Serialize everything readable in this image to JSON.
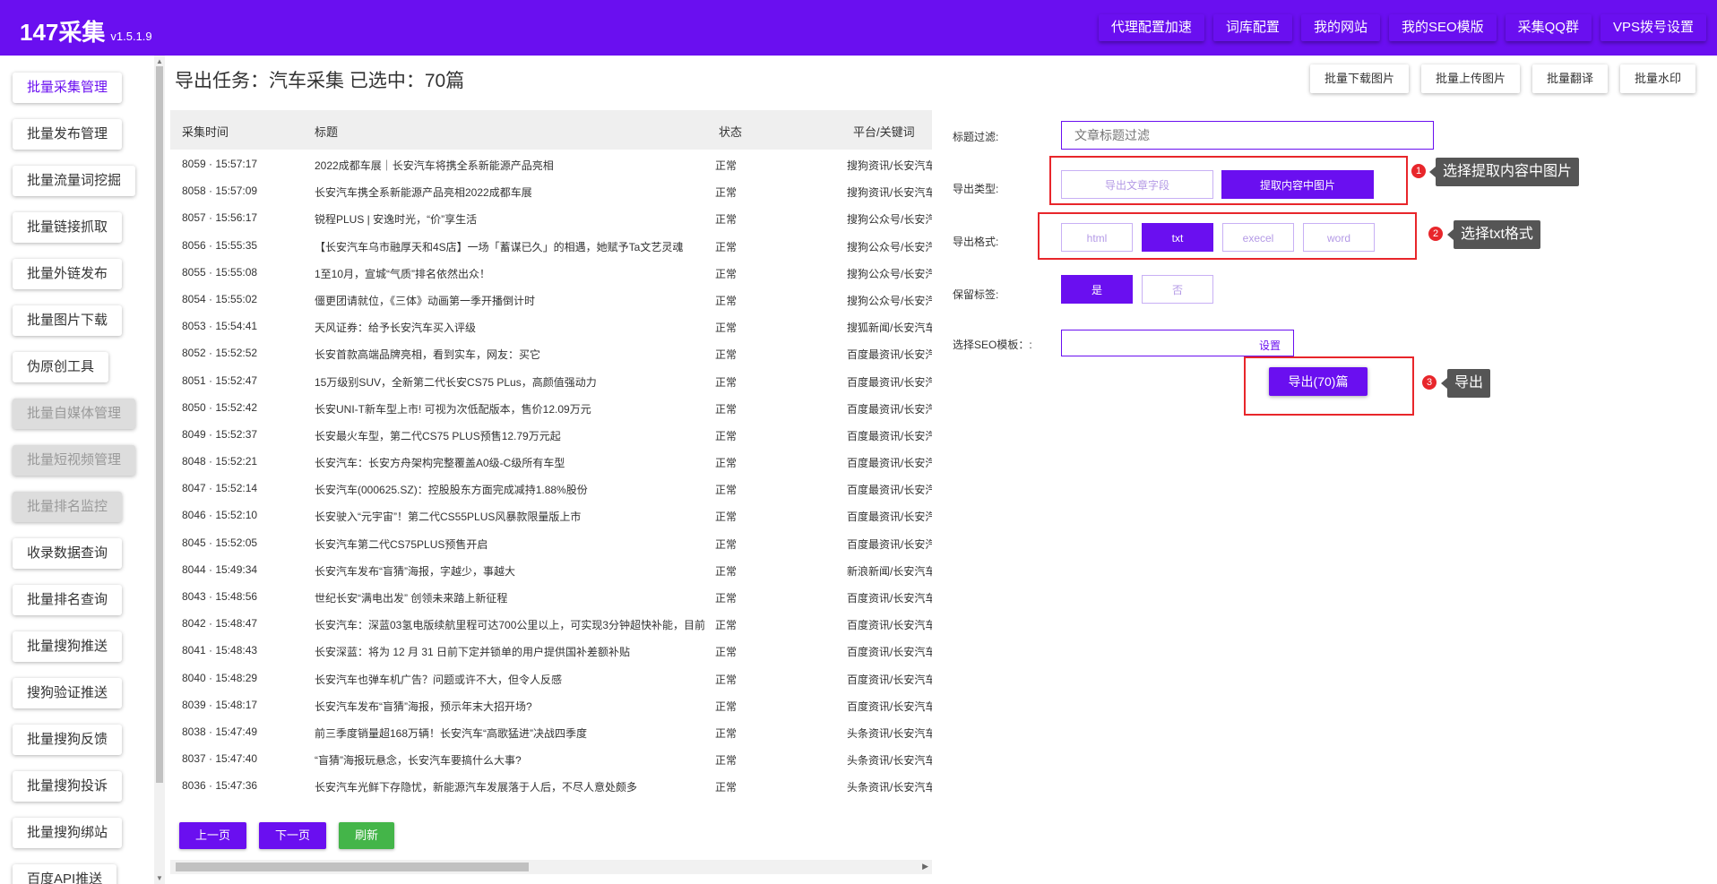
{
  "header": {
    "logo": "147采集",
    "version": "v1.5.1.9",
    "nav": [
      "代理配置加速",
      "词库配置",
      "我的网站",
      "我的SEO模版",
      "采集QQ群",
      "VPS拨号设置"
    ]
  },
  "sidebar": {
    "items": [
      {
        "label": "批量采集管理",
        "state": "active"
      },
      {
        "label": "批量发布管理",
        "state": "normal"
      },
      {
        "label": "批量流量词挖掘",
        "state": "normal"
      },
      {
        "label": "批量链接抓取",
        "state": "normal"
      },
      {
        "label": "批量外链发布",
        "state": "normal"
      },
      {
        "label": "批量图片下载",
        "state": "normal"
      },
      {
        "label": "伪原创工具",
        "state": "normal"
      },
      {
        "label": "批量自媒体管理",
        "state": "disabled"
      },
      {
        "label": "批量短视频管理",
        "state": "disabled"
      },
      {
        "label": "批量排名监控",
        "state": "disabled"
      },
      {
        "label": "收录数据查询",
        "state": "normal"
      },
      {
        "label": "批量排名查询",
        "state": "normal"
      },
      {
        "label": "批量搜狗推送",
        "state": "normal"
      },
      {
        "label": "搜狗验证推送",
        "state": "normal"
      },
      {
        "label": "批量搜狗反馈",
        "state": "normal"
      },
      {
        "label": "批量搜狗投诉",
        "state": "normal"
      },
      {
        "label": "批量搜狗绑站",
        "state": "normal"
      },
      {
        "label": "百度API推送",
        "state": "normal"
      }
    ]
  },
  "main": {
    "title": "导出任务：汽车采集 已选中：70篇",
    "toolbar": [
      "批量下载图片",
      "批量上传图片",
      "批量翻译",
      "批量水印"
    ],
    "table": {
      "headers": [
        "采集时间",
        "标题",
        "状态",
        "平台/关键词"
      ],
      "rows": [
        [
          "8059 · 15:57:17",
          "2022成都车展｜长安汽车将携全系新能源产品亮相",
          "正常",
          "搜狗资讯/长安汽车"
        ],
        [
          "8058 · 15:57:09",
          "长安汽车携全系新能源产品亮相2022成都车展",
          "正常",
          "搜狗资讯/长安汽车"
        ],
        [
          "8057 · 15:56:17",
          "锐程PLUS | 安逸时光，“价”享生活",
          "正常",
          "搜狗公众号/长安汽车"
        ],
        [
          "8056 · 15:55:35",
          "【长安汽车乌市融厚天和4S店】一场「蓄谋已久」的相遇，她赋予Ta文艺灵魂",
          "正常",
          "搜狗公众号/长安汽车"
        ],
        [
          "8055 · 15:55:08",
          "1至10月，宣城“气质”排名依然出众！",
          "正常",
          "搜狗公众号/长安汽车"
        ],
        [
          "8054 · 15:55:02",
          "僵更团请就位，《三体》动画第一季开播倒计时",
          "正常",
          "搜狗公众号/长安汽车"
        ],
        [
          "8053 · 15:54:41",
          "天风证券：给予长安汽车买入评级",
          "正常",
          "搜狐新闻/长安汽车"
        ],
        [
          "8052 · 15:52:52",
          "长安首款高端品牌亮相，看到实车，网友：买它",
          "正常",
          "百度最资讯/长安汽车"
        ],
        [
          "8051 · 15:52:47",
          "15万级别SUV，全新第二代长安CS75 PLus，高颜值强动力",
          "正常",
          "百度最资讯/长安汽车"
        ],
        [
          "8050 · 15:52:42",
          "长安UNI-T新车型上市! 可视为次低配版本，售价12.09万元",
          "正常",
          "百度最资讯/长安汽车"
        ],
        [
          "8049 · 15:52:37",
          "长安最火车型，第二代CS75 PLUS预售12.79万元起",
          "正常",
          "百度最资讯/长安汽车"
        ],
        [
          "8048 · 15:52:21",
          "长安汽车：长安方舟架构完整覆盖A0级-C级所有车型",
          "正常",
          "百度最资讯/长安汽车"
        ],
        [
          "8047 · 15:52:14",
          "长安汽车(000625.SZ)：控股股东方面完成减持1.88%股份",
          "正常",
          "百度最资讯/长安汽车"
        ],
        [
          "8046 · 15:52:10",
          "长安驶入“元宇宙”！第二代CS55PLUS风暴款限量版上市",
          "正常",
          "百度最资讯/长安汽车"
        ],
        [
          "8045 · 15:52:05",
          "长安汽车第二代CS75PLUS预售开启",
          "正常",
          "百度最资讯/长安汽车"
        ],
        [
          "8044 · 15:49:34",
          "长安汽车发布“盲猜”海报，字越少，事越大",
          "正常",
          "新浪新闻/长安汽车"
        ],
        [
          "8043 · 15:48:56",
          "世纪长安“满电出发” 创领未来踏上新征程",
          "正常",
          "百度资讯/长安汽车"
        ],
        [
          "8042 · 15:48:47",
          "长安汽车：深蓝03氢电版续航里程可达700公里以上，可实现3分钟超快补能，目前",
          "正常",
          "百度资讯/长安汽车"
        ],
        [
          "8041 · 15:48:43",
          "长安深蓝：将为 12 月 31 日前下定并锁单的用户提供国补差额补贴",
          "正常",
          "百度资讯/长安汽车"
        ],
        [
          "8040 · 15:48:29",
          "长安汽车也弹车机广告？问题或许不大，但令人反感",
          "正常",
          "百度资讯/长安汽车"
        ],
        [
          "8039 · 15:48:17",
          "长安汽车发布“盲猜”海报，预示年末大招开场?",
          "正常",
          "百度资讯/长安汽车"
        ],
        [
          "8038 · 15:47:49",
          "前三季度销量超168万辆！长安汽车“高歌猛进”决战四季度",
          "正常",
          "头条资讯/长安汽车"
        ],
        [
          "8037 · 15:47:40",
          "“盲猜”海报玩悬念，长安汽车要搞什么大事?",
          "正常",
          "头条资讯/长安汽车"
        ],
        [
          "8036 · 15:47:36",
          "长安汽车光鲜下存隐忧，新能源汽车发展落于人后，不尽人意处颇多",
          "正常",
          "头条资讯/长安汽车"
        ]
      ]
    },
    "pager": {
      "prev": "上一页",
      "next": "下一页",
      "refresh": "刷新"
    }
  },
  "export_panel": {
    "title_filter_label": "标题过滤:",
    "title_filter_placeholder": "文章标题过滤",
    "type_label": "导出类型:",
    "type_options": [
      "导出文章字段",
      "提取内容中图片"
    ],
    "type_selected": "提取内容中图片",
    "format_label": "导出格式:",
    "format_options": [
      "html",
      "txt",
      "execel",
      "word"
    ],
    "format_selected": "txt",
    "keep_tags_label": "保留标签:",
    "keep_tags_options": [
      "是",
      "否"
    ],
    "keep_tags_selected": "是",
    "seo_label": "选择SEO模板：:",
    "seo_button": "设置",
    "export_button": "导出(70)篇"
  },
  "annotations": [
    {
      "num": "1",
      "text": "选择提取内容中图片"
    },
    {
      "num": "2",
      "text": "选择txt格式"
    },
    {
      "num": "3",
      "text": "导出"
    }
  ],
  "colors": {
    "primary": "#6a0ff0",
    "annotation": "#e8262b",
    "refresh": "#44b549"
  }
}
